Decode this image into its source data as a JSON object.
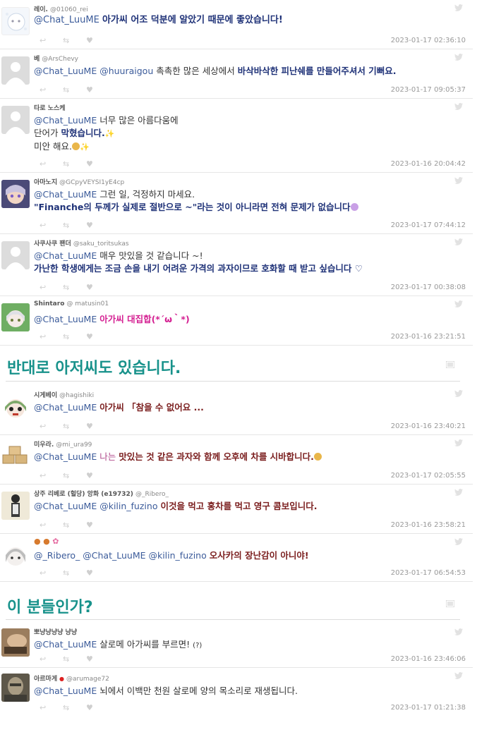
{
  "tweets1": [
    {
      "name": "레이.",
      "handle": "@01060_rei",
      "mention": "@Chat_LuuME",
      "text": "아가씨 어조 덕분에 알았기 때문에 좋았습니다!",
      "style": "navy",
      "time": "2023-01-17 02:36:10",
      "avatar": "ghost"
    },
    {
      "name": "베",
      "handle": "@ArsChevy",
      "mention": "@Chat_LuuME  @huuraigou",
      "pre": "촉촉한 많은 세상에서",
      "text": "바삭바삭한 피난쉐를 만들어주셔서 기뻐요.",
      "style": "navy",
      "time": "2023-01-17 09:05:37",
      "avatar": "default"
    },
    {
      "name": "타로 노스케",
      "handle": "",
      "mention": "@Chat_LuuME",
      "pre": "너무 많은 아름다움에",
      "line2a": "단어가",
      "line2b": "막혔습니다.",
      "line3": "미안 해요.",
      "style": "dark",
      "time": "2023-01-16 20:04:42",
      "avatar": "default"
    },
    {
      "name": "아마노지",
      "handle": "@GCpyVEYSI1yE4cp",
      "mention": "@Chat_LuuME",
      "pre": "그런 일, 걱정하지 마세요.",
      "text": "\"Finanche의 두께가 실제로 절반으로 ~\"라는 것이 아니라면 전혀 문제가 없습니다",
      "style": "navy",
      "time": "2023-01-17 07:44:12",
      "avatar": "char1"
    },
    {
      "name": "사쿠사쿠 팬더",
      "handle": "@saku_toritsukas",
      "mention": "@Chat_LuuME",
      "pre": "매우 맛있을 것 같습니다 ~!",
      "text": "가난한 학생에게는 조금 손을 내기 어려운 가격의 과자이므로 호화할 때 받고 싶습니다 ♡",
      "style": "navy",
      "time": "2023-01-17 00:38:08",
      "avatar": "default"
    },
    {
      "name": "Shintaro",
      "handle": "@ matusin01",
      "mention": "@Chat_LuuME",
      "text": "아가씨 대집합(*´ω｀*)",
      "style": "pink",
      "time": "2023-01-16 23:21:51",
      "avatar": "char2"
    }
  ],
  "section1": "반대로 아저씨도 있습니다.",
  "tweets2": [
    {
      "name": "시게베이",
      "handle": "@hagishiki",
      "mention": "@Chat_LuuME",
      "text": "아가씨 「참을 수 없어요 ...",
      "style": "mar",
      "time": "2023-01-16 23:40:21",
      "avatar": "char3"
    },
    {
      "name": "미우라.",
      "handle": "@mi_ura99",
      "mention": "@Chat_LuuME",
      "pre2": "나는",
      "text": "맛있는 것 같은 과자와 함께 오후에 차를 시바합니다.",
      "style": "mar",
      "time": "2023-01-17 02:05:55",
      "avatar": "boxes"
    },
    {
      "name": "상주 리베로 (헐당) 앙화 (e19732)",
      "handle": "@_Ribero_",
      "mention": "@Chat_LuuME  @kilin_fuzino",
      "text": "이것을 먹고 홍차를 먹고 영구 콤보입니다.",
      "style": "mar",
      "time": "2023-01-16 23:58:21",
      "avatar": "char4"
    },
    {
      "name": "",
      "handle": "",
      "mention": "@_Ribero_  @Chat_LuuME  @kilin_fuzino",
      "text": "오사카의 장난감이 아니야!",
      "style": "mar",
      "time": "2023-01-17 06:54:53",
      "avatar": "char5"
    }
  ],
  "section2": "이 분들인가?",
  "tweets3": [
    {
      "name": "뽀냥냥냥냥 냥냥",
      "handle": "",
      "mention": "@Chat_LuuME",
      "text": "살로메 아가씨를 부르면!",
      "suffix": "(?)",
      "style": "dark",
      "time": "2023-01-16 23:46:06",
      "avatar": "photo1"
    },
    {
      "name": "아르마게",
      "handle": "@arumage72",
      "mention": "@Chat_LuuME",
      "text": "뇌에서 이백만 천원 살로메 양의 목소리로 재생됩니다.",
      "style": "dark",
      "time": "2023-01-17 01:21:38",
      "avatar": "photo2"
    }
  ],
  "action_icons": [
    "reply-icon",
    "retweet-icon",
    "like-icon"
  ],
  "colors": {
    "section_title": "#18928b",
    "mention": "#3b5b9a",
    "navy_text": "#1f3278",
    "maroon_text": "#7a1d1d",
    "pink_text": "#d41e91"
  }
}
